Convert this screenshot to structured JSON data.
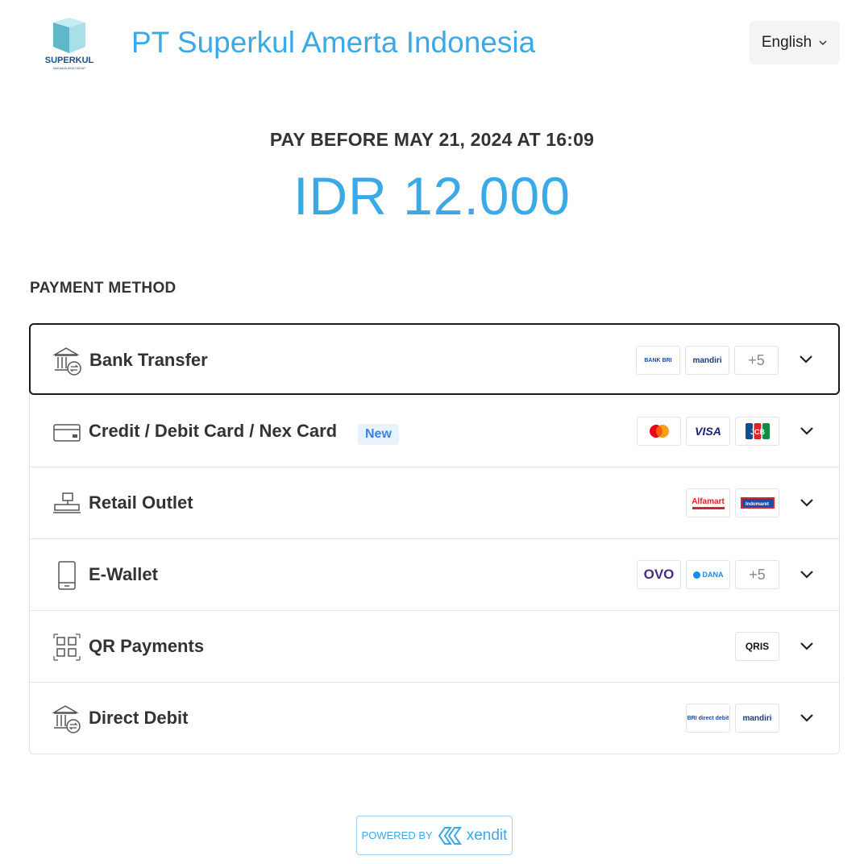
{
  "header": {
    "logo_text": "SUPERKUL",
    "logo_subtext": "MAKANAN BEKU SEHAT",
    "merchant_name": "PT Superkul Amerta Indonesia",
    "language": "English"
  },
  "deadline": "PAY BEFORE MAY 21, 2024 AT 16:09",
  "amount": "IDR 12.000",
  "payment_method_heading": "PAYMENT METHOD",
  "methods": [
    {
      "label": "Bank Transfer",
      "icon": "bank-icon",
      "logos": [
        "BANK BRI",
        "mandiri"
      ],
      "more": "+5",
      "selected": true
    },
    {
      "label": "Credit / Debit Card / Nex Card",
      "icon": "card-icon",
      "badge": "New",
      "logos": [
        "mastercard",
        "VISA",
        "JCB"
      ]
    },
    {
      "label": "Retail Outlet",
      "icon": "cash-register-icon",
      "logos": [
        "Alfamart",
        "Indomaret"
      ]
    },
    {
      "label": "E-Wallet",
      "icon": "phone-icon",
      "logos": [
        "OVO",
        "DANA"
      ],
      "more": "+5"
    },
    {
      "label": "QR Payments",
      "icon": "qr-icon",
      "logos": [
        "QRIS"
      ]
    },
    {
      "label": "Direct Debit",
      "icon": "bank-icon",
      "logos": [
        "BRI direct debit",
        "mandiri"
      ]
    }
  ],
  "footer": {
    "powered_by": "POWERED BY",
    "brand": "xendit"
  },
  "colors": {
    "accent": "#3aa9e6",
    "text": "#333333",
    "border": "#e3e3e3",
    "badge_bg": "#e8f2fd",
    "badge_text": "#3b82e0"
  }
}
